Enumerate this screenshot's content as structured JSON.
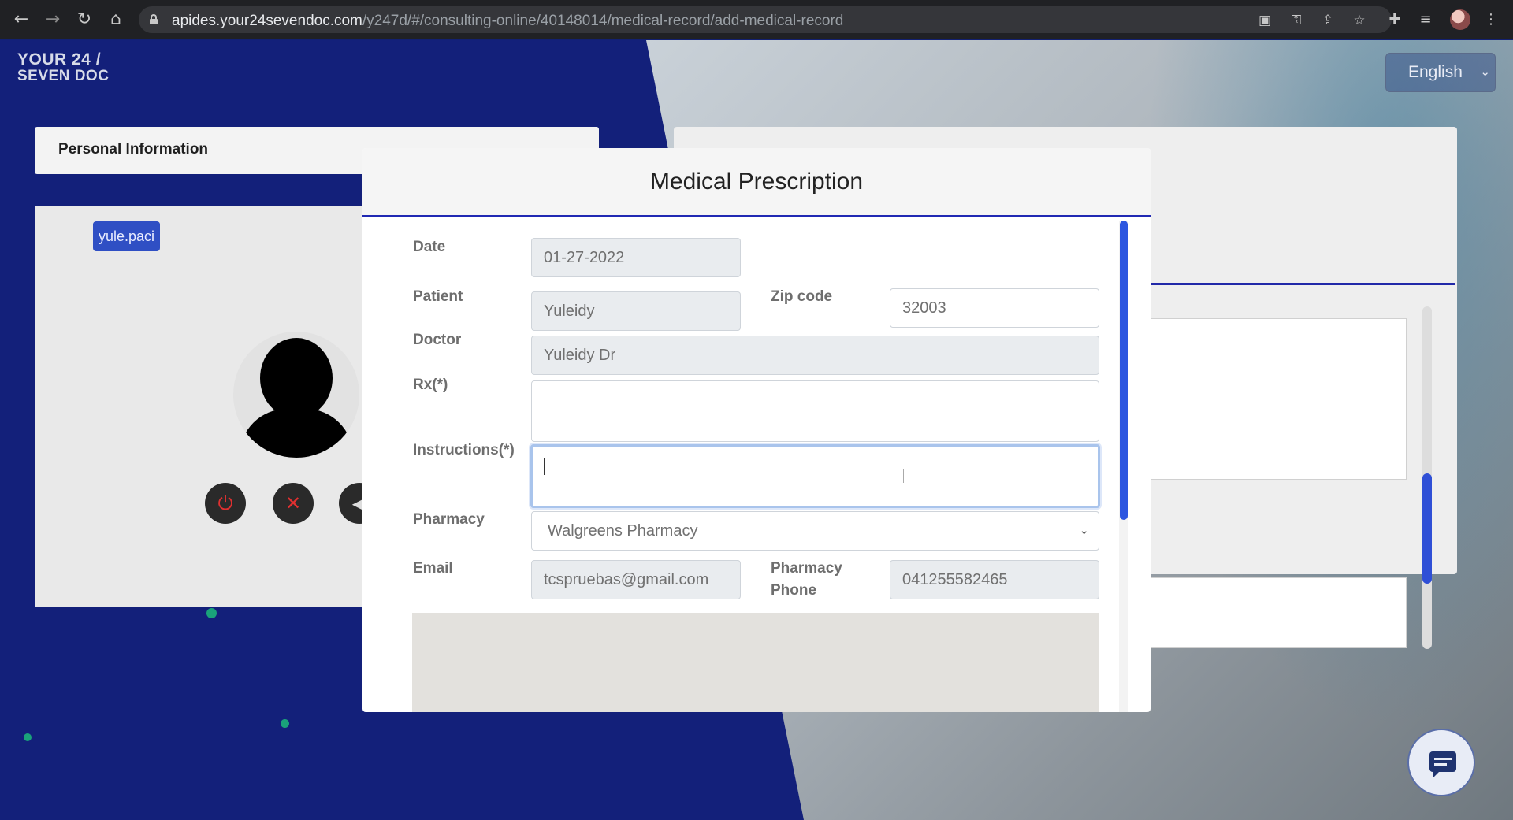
{
  "browser": {
    "url_host": "apides.your24sevendoc.com",
    "url_path": "/y247d/#/consulting-online/40148014/medical-record/add-medical-record"
  },
  "header": {
    "logo_line1": "YOUR 24 /",
    "logo_line2": "SEVEN DOC",
    "language": "English"
  },
  "left_panel": {
    "title": "Personal Information",
    "user_tag": "yule.paci"
  },
  "modal": {
    "title": "Medical Prescription",
    "fields": {
      "date": {
        "label": "Date",
        "value": "01-27-2022"
      },
      "patient": {
        "label": "Patient",
        "value": "Yuleidy"
      },
      "zip": {
        "label": "Zip code",
        "value": "32003"
      },
      "doctor": {
        "label": "Doctor",
        "value": "Yuleidy Dr"
      },
      "rx": {
        "label": "Rx(*)",
        "value": ""
      },
      "instructions": {
        "label": "Instructions(*)",
        "value": ""
      },
      "pharmacy": {
        "label": "Pharmacy",
        "value": "Walgreens Pharmacy"
      },
      "email": {
        "label": "Email",
        "value": "tcspruebas@gmail.com"
      },
      "pharmacy_phone": {
        "label_line1": "Pharmacy",
        "label_line2": "Phone",
        "value": "041255582465"
      }
    }
  },
  "colors": {
    "page_bg": "#13207a",
    "accent": "#2129b3",
    "scroll_thumb": "#2c56e0"
  },
  "icons": [
    "back-arrow-icon",
    "forward-arrow-icon",
    "reload-icon",
    "home-icon",
    "lock-icon",
    "camera-icon",
    "key-icon",
    "share-icon",
    "star-icon",
    "extensions-icon",
    "media-control-icon",
    "menu-dots-icon",
    "power-icon",
    "mic-off-icon",
    "speaker-icon",
    "chat-icon"
  ]
}
